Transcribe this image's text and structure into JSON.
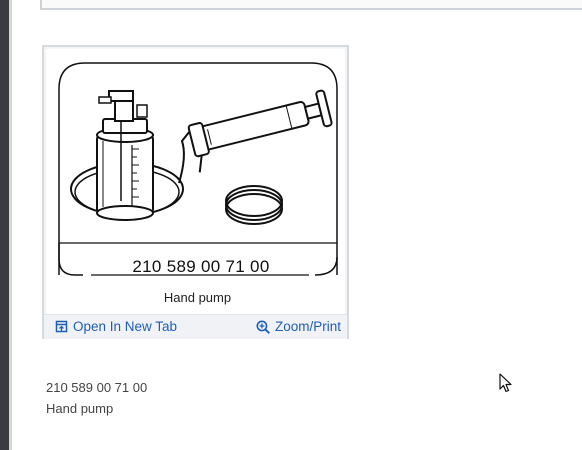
{
  "card": {
    "part_number": "210 589 00 71 00",
    "caption": "Hand pump",
    "open_link": "Open In New Tab",
    "zoom_link": "Zoom/Print",
    "open_icon": "open-new-tab-icon",
    "zoom_icon": "magnifier-plus-icon"
  },
  "details": {
    "part_number": "210 589 00 71 00",
    "name": "Hand pump"
  },
  "colors": {
    "link": "#1f5fb4",
    "card_border": "#d6d9de",
    "footer_bg": "#f0f2f5"
  }
}
